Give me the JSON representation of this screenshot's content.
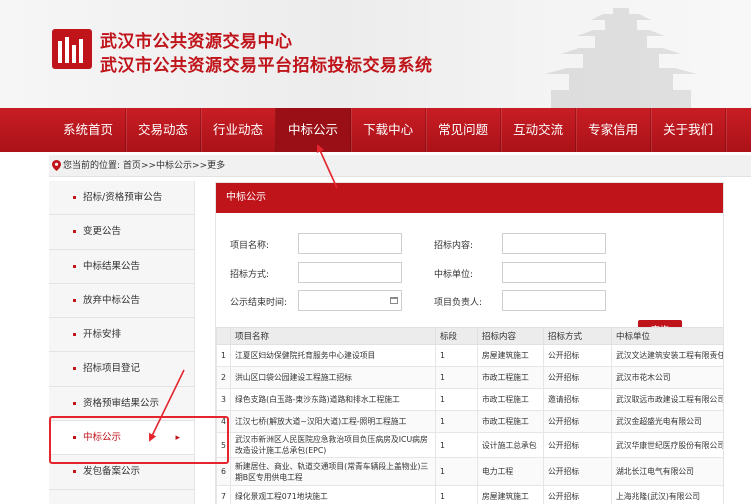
{
  "header": {
    "title_line1": "武汉市公共资源交易中心",
    "title_line2": "武汉市公共资源交易平台招标投标交易系统"
  },
  "nav": {
    "items": [
      {
        "label": "系统首页"
      },
      {
        "label": "交易动态"
      },
      {
        "label": "行业动态"
      },
      {
        "label": "中标公示"
      },
      {
        "label": "下载中心"
      },
      {
        "label": "常见问题"
      },
      {
        "label": "互动交流"
      },
      {
        "label": "专家信用"
      },
      {
        "label": "关于我们"
      }
    ],
    "active_index": 3
  },
  "breadcrumb": {
    "prefix": "您当前的位置:",
    "home": "首页",
    "sep": ">>",
    "section": "中标公示",
    "current": "更多"
  },
  "sidebar": {
    "items": [
      {
        "label": "招标/资格预审公告"
      },
      {
        "label": "变更公告"
      },
      {
        "label": "中标结果公告"
      },
      {
        "label": "放弃中标公告"
      },
      {
        "label": "开标安排"
      },
      {
        "label": "招标项目登记"
      },
      {
        "label": "资格预审结果公示"
      },
      {
        "label": "中标公示"
      },
      {
        "label": "发包备案公示"
      }
    ],
    "active_index": 7,
    "active_chevron": "▸"
  },
  "main": {
    "heading": "中标公示",
    "form": {
      "project_name_label": "项目名称:",
      "tender_content_label": "招标内容:",
      "tender_method_label": "招标方式:",
      "winner_label": "中标单位:",
      "publish_end_label": "公示结束时间:",
      "project_leader_label": "项目负责人:",
      "project_name_value": "",
      "tender_content_value": "",
      "tender_method_value": "",
      "winner_value": "",
      "publish_end_value": "",
      "project_leader_value": "",
      "calendar_icon": "calendar-icon",
      "search_button": "查询"
    },
    "table": {
      "columns": [
        "",
        "项目名称",
        "标段",
        "招标内容",
        "招标方式",
        "中标单位"
      ],
      "rows": [
        {
          "no": "1",
          "name": "江夏区妇幼保健院托育服务中心建设项目",
          "section": "1",
          "content": "房屋建筑施工",
          "method": "公开招标",
          "winner": "武汉文达建筑安装工程有限责任公司"
        },
        {
          "no": "2",
          "name": "洪山区口袋公园建设工程施工招标",
          "section": "1",
          "content": "市政工程施工",
          "method": "公开招标",
          "winner": "武汉市花木公司"
        },
        {
          "no": "3",
          "name": "绿色支路(白玉路-東沙东路)道路和排水工程施工",
          "section": "1",
          "content": "市政工程施工",
          "method": "邀请招标",
          "winner": "武汉取远市政建设工程有限公司"
        },
        {
          "no": "4",
          "name": "江汉七桥(解放大道~汉阳大道)工程-照明工程施工",
          "section": "1",
          "content": "市政工程施工",
          "method": "公开招标",
          "winner": "武汉金超盛光电有限公司"
        },
        {
          "no": "5",
          "name": "武汉市新洲区人民医院应急救治项目负压病房及ICU病房改造设计施工总承包(EPC)",
          "section": "1",
          "content": "设计施工总承包",
          "method": "公开招标",
          "winner": "武汉华康世纪医疗股份有限公司"
        },
        {
          "no": "6",
          "name": "新建居住、商业、轨道交通项目(常青车辆段上盖物业)三期B区专用供电工程",
          "section": "1",
          "content": "电力工程",
          "method": "公开招标",
          "winner": "湖北长江电气有限公司"
        },
        {
          "no": "7",
          "name": "绿化景观工程071地块施工",
          "section": "1",
          "content": "房屋建筑施工",
          "method": "公开招标",
          "winner": "上海兆隆(武汉)有限公司"
        }
      ]
    }
  },
  "colors": {
    "brand_red": "#c0141b",
    "nav_red": "#b8171e",
    "annotation_red": "#e4252d"
  }
}
